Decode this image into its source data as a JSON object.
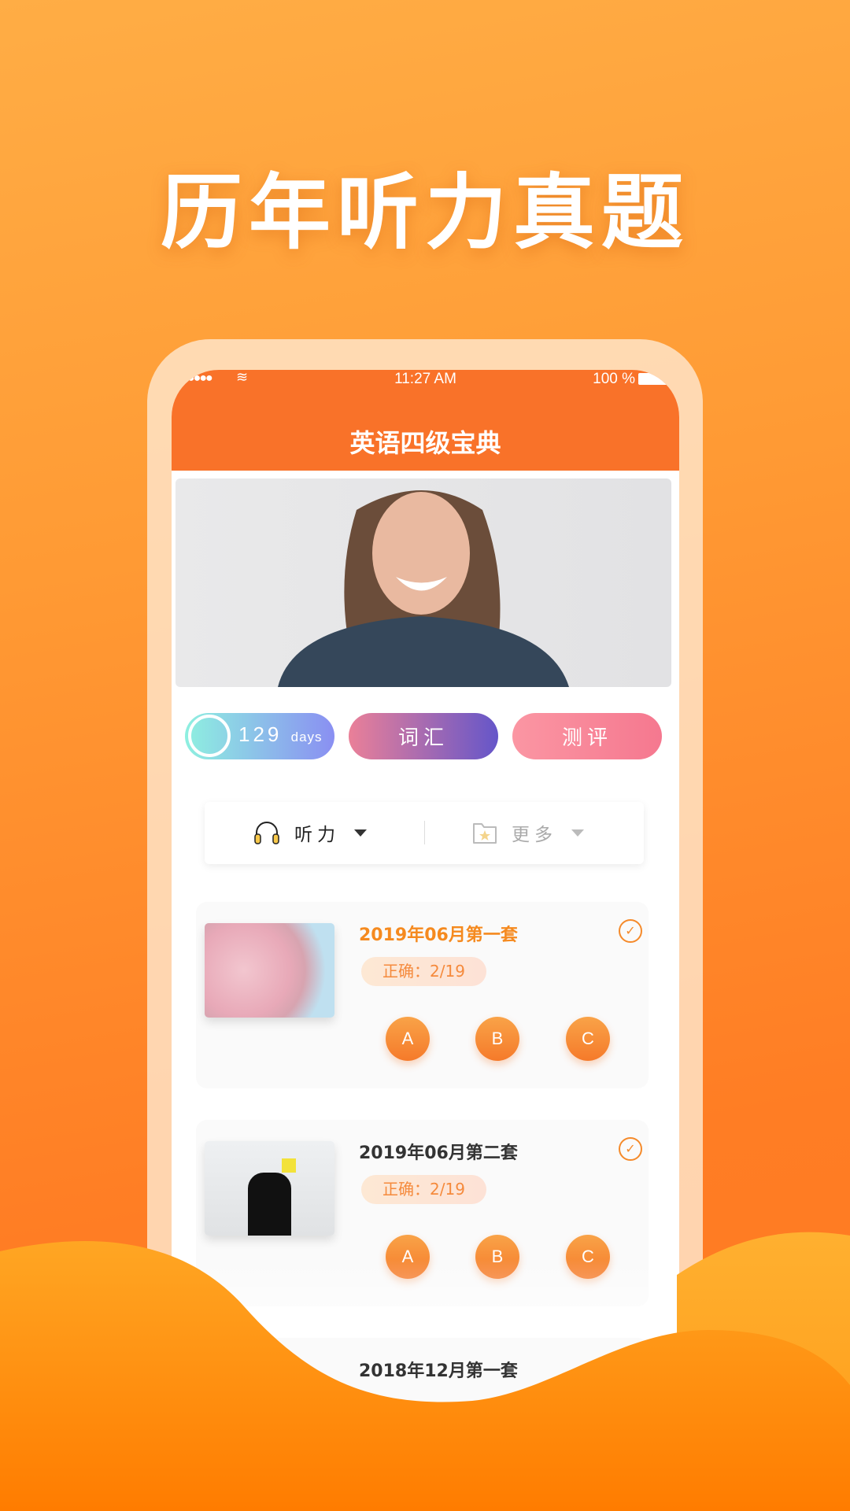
{
  "headline": "历年听力真题",
  "status_bar": {
    "time": "11:27 AM",
    "battery": "100 %"
  },
  "app": {
    "title": "英语四级宝典"
  },
  "quick_buttons": {
    "countdown_number": "129",
    "countdown_unit": "days",
    "vocab": "词汇",
    "test": "测评"
  },
  "filter": {
    "listening": "听力",
    "more": "更多"
  },
  "cards": [
    {
      "title": "2019年06月第一套",
      "score": "正确：2/19",
      "options": [
        "A",
        "B",
        "C"
      ],
      "title_color": "#f58a1f"
    },
    {
      "title": "2019年06月第二套",
      "score": "正确：2/19",
      "options": [
        "A",
        "B",
        "C"
      ],
      "title_color": "#333333"
    },
    {
      "title": "2018年12月第一套",
      "title_color": "#333333"
    }
  ],
  "colors": {
    "accent": "#f97229",
    "background": "#ff9a34",
    "wave": "#ff9a1a"
  }
}
